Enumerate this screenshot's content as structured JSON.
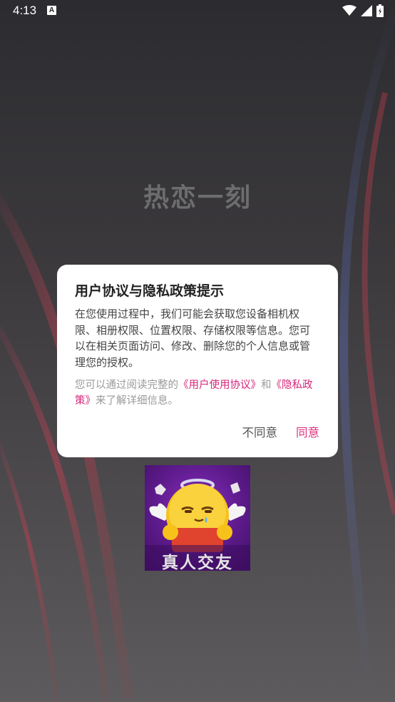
{
  "status_bar": {
    "time": "4:13",
    "notification_letter": "A"
  },
  "app": {
    "title": "热恋一刻"
  },
  "dialog": {
    "title": "用户协议与隐私政策提示",
    "body": "在您使用过程中，我们可能会获取您设备相机权限、相册权限、位置权限、存储权限等信息。您可以在相关页面访问、修改、删除您的个人信息或管理您的授权。",
    "hint_prefix": "您可以通过阅读完整的",
    "user_agreement_link": "《用户使用协议》",
    "hint_and": "和",
    "privacy_link": "《隐私政策》",
    "hint_suffix": "来了解详细信息。",
    "disagree_label": "不同意",
    "agree_label": "同意"
  },
  "promo": {
    "caption": "真人交友"
  },
  "colors": {
    "accent": "#e0307f",
    "link": "#d6247a"
  },
  "icons": [
    "wifi-icon",
    "signal-icon",
    "battery-icon",
    "notification-a-icon"
  ]
}
